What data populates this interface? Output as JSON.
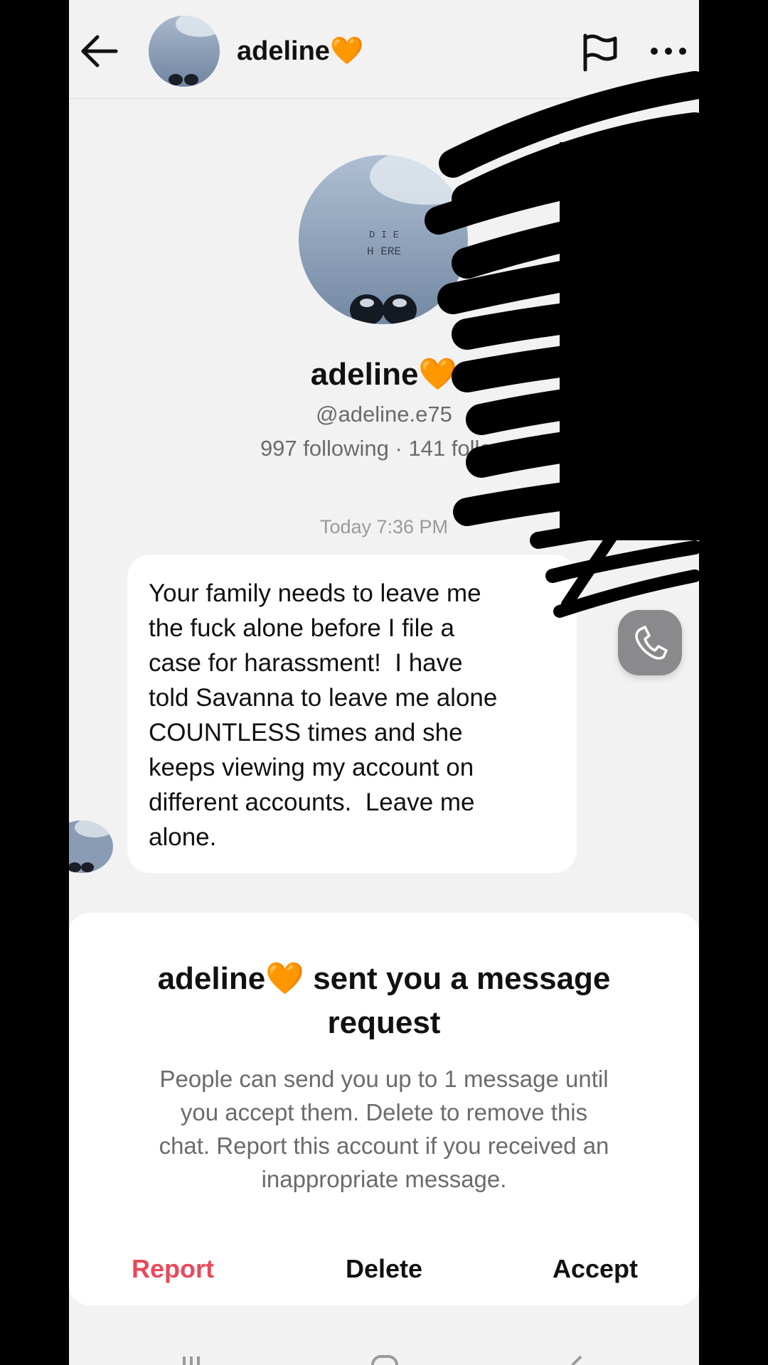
{
  "header": {
    "title": "adeline🧡",
    "back_icon": "arrow-left-icon",
    "flag_icon": "flag-icon",
    "more_icon": "more-horizontal-icon"
  },
  "profile": {
    "name": "adeline🧡",
    "handle": "@adeline.e75",
    "stats": "997 following · 141 follow",
    "avatar_text": [
      "D I E",
      "H ERE"
    ]
  },
  "conversation": {
    "timestamp": "Today 7:36 PM",
    "message_lines": [
      "Your family needs to leave me",
      "the fuck alone before I file a",
      "case for harassment!  I have",
      "told Savanna to leave me alone",
      "COUNTLESS times and she",
      "keeps viewing my account on",
      "different accounts.  Leave me",
      "alone."
    ],
    "call_icon": "phone-icon"
  },
  "request": {
    "title_lines": [
      "adeline🧡 sent you a message",
      "request"
    ],
    "body_lines": [
      "People can send you up to 1 message until",
      "you accept them. Delete to remove this",
      "chat. Report this account if you received an",
      "inappropriate message."
    ],
    "report_label": "Report",
    "delete_label": "Delete",
    "accept_label": "Accept"
  },
  "colors": {
    "background": "#f2f2f3",
    "report": "#e8495a",
    "call_button": "#8a8a8c"
  }
}
